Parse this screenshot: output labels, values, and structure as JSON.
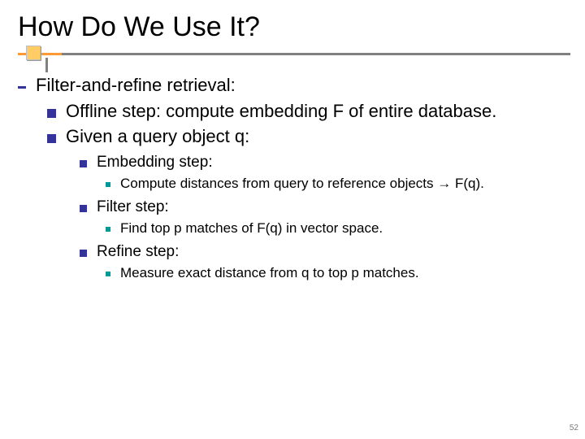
{
  "title": "How Do We Use It?",
  "l1": "Filter-and-refine retrieval:",
  "l2a": "Offline step: compute embedding F of entire database.",
  "l2b": "Given a query object q:",
  "l3a": "Embedding step:",
  "l4a": "Compute distances from query to reference objects → F(q).",
  "l3b": "Filter step:",
  "l4b": "Find top p matches of F(q) in vector space.",
  "l3c": "Refine step:",
  "l4c": "Measure exact distance from q to top p matches.",
  "page": "52"
}
